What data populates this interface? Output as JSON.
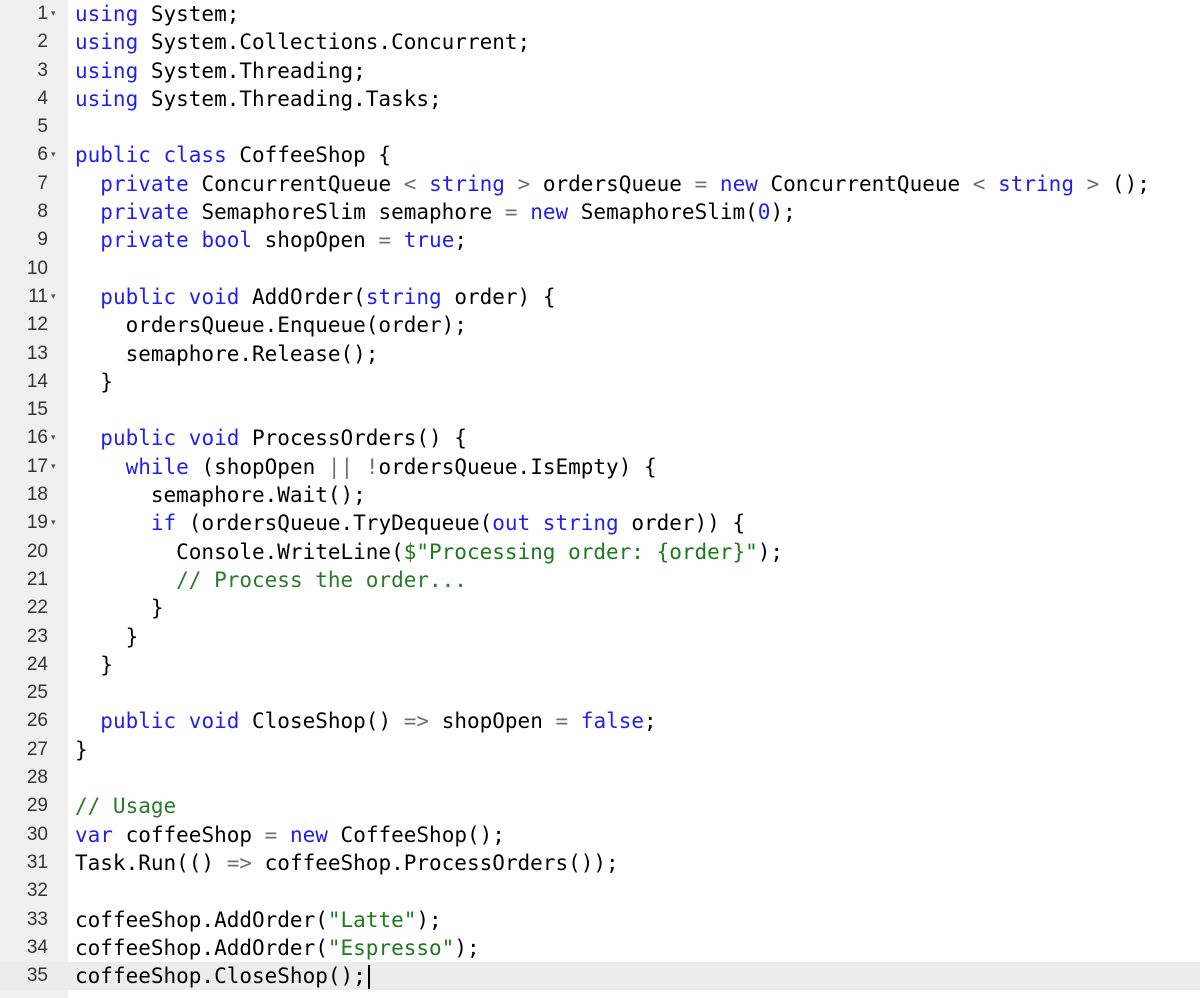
{
  "editor": {
    "active_line": 35,
    "lines": [
      {
        "n": "1",
        "fold": true,
        "tokens": [
          [
            "kw",
            "using"
          ],
          [
            "pl",
            " System;"
          ]
        ]
      },
      {
        "n": "2",
        "fold": false,
        "tokens": [
          [
            "kw",
            "using"
          ],
          [
            "pl",
            " System.Collections.Concurrent;"
          ]
        ]
      },
      {
        "n": "3",
        "fold": false,
        "tokens": [
          [
            "kw",
            "using"
          ],
          [
            "pl",
            " System.Threading;"
          ]
        ]
      },
      {
        "n": "4",
        "fold": false,
        "tokens": [
          [
            "kw",
            "using"
          ],
          [
            "pl",
            " System.Threading.Tasks;"
          ]
        ]
      },
      {
        "n": "5",
        "fold": false,
        "tokens": []
      },
      {
        "n": "6",
        "fold": true,
        "tokens": [
          [
            "kw",
            "public class"
          ],
          [
            "pl",
            " CoffeeShop {"
          ]
        ]
      },
      {
        "n": "7",
        "fold": false,
        "tokens": [
          [
            "pl",
            "  "
          ],
          [
            "kw",
            "private"
          ],
          [
            "pl",
            " ConcurrentQueue "
          ],
          [
            "op",
            "<"
          ],
          [
            "pl",
            " "
          ],
          [
            "kw",
            "string"
          ],
          [
            "pl",
            " "
          ],
          [
            "op",
            ">"
          ],
          [
            "pl",
            " ordersQueue "
          ],
          [
            "op",
            "="
          ],
          [
            "pl",
            " "
          ],
          [
            "kw",
            "new"
          ],
          [
            "pl",
            " ConcurrentQueue "
          ],
          [
            "op",
            "<"
          ],
          [
            "pl",
            " "
          ],
          [
            "kw",
            "string"
          ],
          [
            "pl",
            " "
          ],
          [
            "op",
            ">"
          ],
          [
            "pl",
            " ();"
          ]
        ]
      },
      {
        "n": "8",
        "fold": false,
        "tokens": [
          [
            "pl",
            "  "
          ],
          [
            "kw",
            "private"
          ],
          [
            "pl",
            " SemaphoreSlim semaphore "
          ],
          [
            "op",
            "="
          ],
          [
            "pl",
            " "
          ],
          [
            "kw",
            "new"
          ],
          [
            "pl",
            " SemaphoreSlim("
          ],
          [
            "kw",
            "0"
          ],
          [
            "pl",
            ");"
          ]
        ]
      },
      {
        "n": "9",
        "fold": false,
        "tokens": [
          [
            "pl",
            "  "
          ],
          [
            "kw",
            "private bool"
          ],
          [
            "pl",
            " shopOpen "
          ],
          [
            "op",
            "="
          ],
          [
            "pl",
            " "
          ],
          [
            "kw",
            "true"
          ],
          [
            "pl",
            ";"
          ]
        ]
      },
      {
        "n": "10",
        "fold": false,
        "tokens": []
      },
      {
        "n": "11",
        "fold": true,
        "tokens": [
          [
            "pl",
            "  "
          ],
          [
            "kw",
            "public void"
          ],
          [
            "pl",
            " AddOrder("
          ],
          [
            "kw",
            "string"
          ],
          [
            "pl",
            " order) {"
          ]
        ]
      },
      {
        "n": "12",
        "fold": false,
        "tokens": [
          [
            "pl",
            "    ordersQueue.Enqueue(order);"
          ]
        ]
      },
      {
        "n": "13",
        "fold": false,
        "tokens": [
          [
            "pl",
            "    semaphore.Release();"
          ]
        ]
      },
      {
        "n": "14",
        "fold": false,
        "tokens": [
          [
            "pl",
            "  }"
          ]
        ]
      },
      {
        "n": "15",
        "fold": false,
        "tokens": []
      },
      {
        "n": "16",
        "fold": true,
        "tokens": [
          [
            "pl",
            "  "
          ],
          [
            "kw",
            "public void"
          ],
          [
            "pl",
            " ProcessOrders() {"
          ]
        ]
      },
      {
        "n": "17",
        "fold": true,
        "tokens": [
          [
            "pl",
            "    "
          ],
          [
            "kw",
            "while"
          ],
          [
            "pl",
            " (shopOpen "
          ],
          [
            "op",
            "||"
          ],
          [
            "pl",
            " "
          ],
          [
            "op",
            "!"
          ],
          [
            "pl",
            "ordersQueue.IsEmpty) {"
          ]
        ]
      },
      {
        "n": "18",
        "fold": false,
        "tokens": [
          [
            "pl",
            "      semaphore.Wait();"
          ]
        ]
      },
      {
        "n": "19",
        "fold": true,
        "tokens": [
          [
            "pl",
            "      "
          ],
          [
            "kw",
            "if"
          ],
          [
            "pl",
            " (ordersQueue.TryDequeue("
          ],
          [
            "kw",
            "out string"
          ],
          [
            "pl",
            " order)) {"
          ]
        ]
      },
      {
        "n": "20",
        "fold": false,
        "tokens": [
          [
            "pl",
            "        Console.WriteLine("
          ],
          [
            "str",
            "$\"Processing order: {order}\""
          ],
          [
            "pl",
            ");"
          ]
        ]
      },
      {
        "n": "21",
        "fold": false,
        "tokens": [
          [
            "pl",
            "        "
          ],
          [
            "cm",
            "// Process the order..."
          ]
        ]
      },
      {
        "n": "22",
        "fold": false,
        "tokens": [
          [
            "pl",
            "      }"
          ]
        ]
      },
      {
        "n": "23",
        "fold": false,
        "tokens": [
          [
            "pl",
            "    }"
          ]
        ]
      },
      {
        "n": "24",
        "fold": false,
        "tokens": [
          [
            "pl",
            "  }"
          ]
        ]
      },
      {
        "n": "25",
        "fold": false,
        "tokens": []
      },
      {
        "n": "26",
        "fold": false,
        "tokens": [
          [
            "pl",
            "  "
          ],
          [
            "kw",
            "public void"
          ],
          [
            "pl",
            " CloseShop() "
          ],
          [
            "op",
            "=>"
          ],
          [
            "pl",
            " shopOpen "
          ],
          [
            "op",
            "="
          ],
          [
            "pl",
            " "
          ],
          [
            "kw",
            "false"
          ],
          [
            "pl",
            ";"
          ]
        ]
      },
      {
        "n": "27",
        "fold": false,
        "tokens": [
          [
            "pl",
            "}"
          ]
        ]
      },
      {
        "n": "28",
        "fold": false,
        "tokens": []
      },
      {
        "n": "29",
        "fold": false,
        "tokens": [
          [
            "cm",
            "// Usage"
          ]
        ]
      },
      {
        "n": "30",
        "fold": false,
        "tokens": [
          [
            "kw",
            "var"
          ],
          [
            "pl",
            " coffeeShop "
          ],
          [
            "op",
            "="
          ],
          [
            "pl",
            " "
          ],
          [
            "kw",
            "new"
          ],
          [
            "pl",
            " CoffeeShop();"
          ]
        ]
      },
      {
        "n": "31",
        "fold": false,
        "tokens": [
          [
            "pl",
            "Task.Run(() "
          ],
          [
            "op",
            "=>"
          ],
          [
            "pl",
            " coffeeShop.ProcessOrders());"
          ]
        ]
      },
      {
        "n": "32",
        "fold": false,
        "tokens": []
      },
      {
        "n": "33",
        "fold": false,
        "tokens": [
          [
            "pl",
            "coffeeShop.AddOrder("
          ],
          [
            "str",
            "\"Latte\""
          ],
          [
            "pl",
            ");"
          ]
        ]
      },
      {
        "n": "34",
        "fold": false,
        "tokens": [
          [
            "pl",
            "coffeeShop.AddOrder("
          ],
          [
            "str",
            "\"Espresso\""
          ],
          [
            "pl",
            ");"
          ]
        ]
      },
      {
        "n": "35",
        "fold": false,
        "tokens": [
          [
            "pl",
            "coffeeShop.CloseShop();"
          ]
        ]
      }
    ]
  },
  "colors": {
    "keyword": "#1f1ff5",
    "string": "#1b7a1b",
    "comment": "#2a7a2a",
    "operator": "#707070",
    "gutter": "#f0f0f0",
    "active_line": "#ececec"
  },
  "icons": {
    "fold_marker": "fold-arrow-icon",
    "fold_glyph": "▾"
  }
}
